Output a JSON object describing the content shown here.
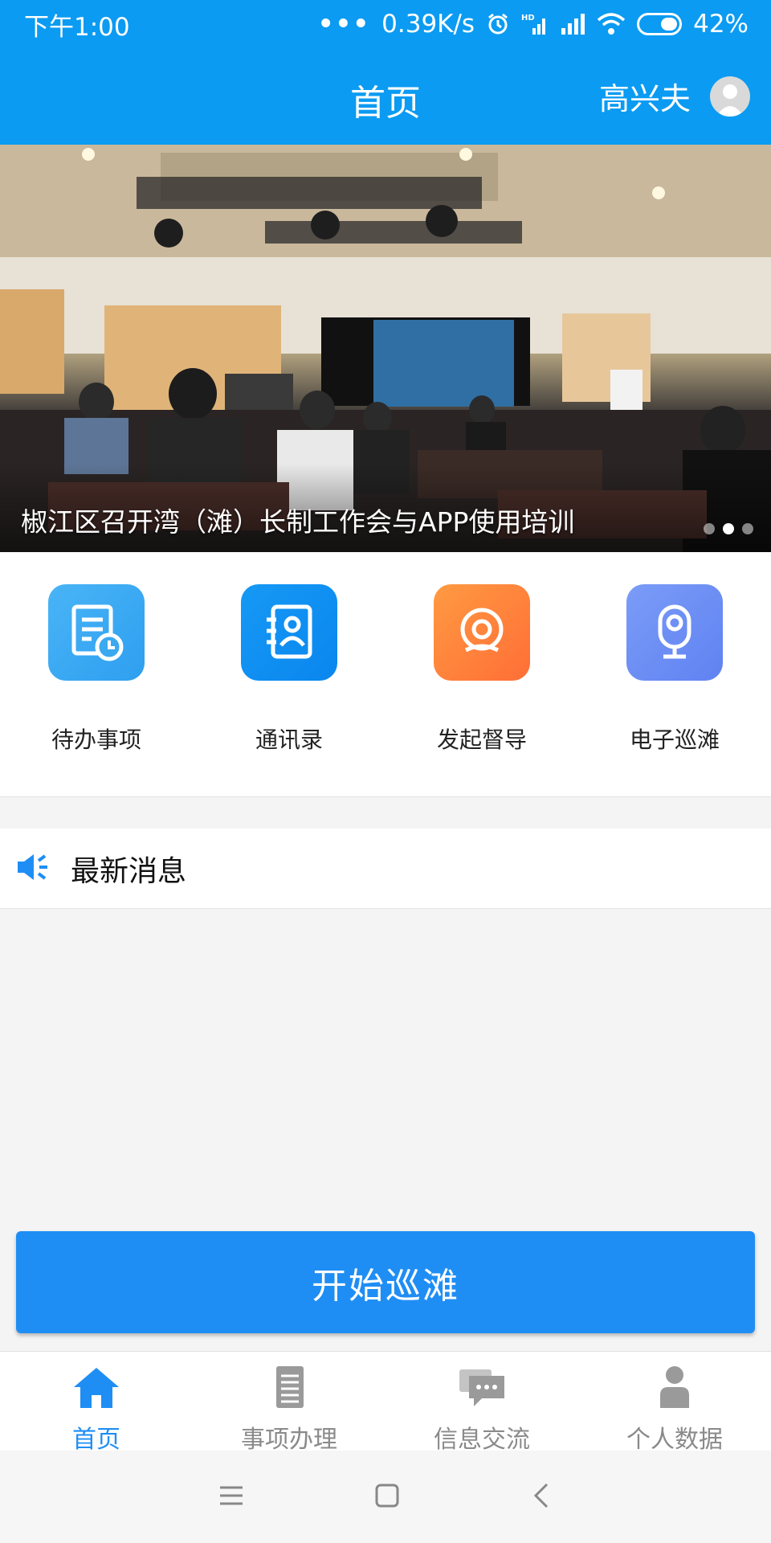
{
  "status_bar": {
    "time": "下午1:00",
    "network_speed": "0.39K/s",
    "battery": "42%",
    "icons": [
      "more-dots-icon",
      "alarm-icon",
      "hd-signal-icon",
      "signal-icon",
      "wifi-icon",
      "battery-icon"
    ]
  },
  "header": {
    "title": "首页",
    "username": "高兴夫",
    "avatar_icon": "user-avatar-icon",
    "color": "#0b9bf2"
  },
  "banner": {
    "caption": "椒江区召开湾（滩）长制工作会与APP使用培训",
    "slide_count": 3,
    "active_slide": 2
  },
  "quick_menu": {
    "items": [
      {
        "label": "待办事项",
        "icon": "todo-clock-icon",
        "color": "#3aa9f0"
      },
      {
        "label": "通讯录",
        "icon": "contacts-book-icon",
        "color": "#1e90f2"
      },
      {
        "label": "发起督导",
        "icon": "webcam-icon",
        "color": "#ff7e3b"
      },
      {
        "label": "电子巡滩",
        "icon": "camera-icon",
        "color": "#6b8cf5"
      }
    ]
  },
  "news": {
    "title": "最新消息",
    "icon": "megaphone-icon"
  },
  "start_button": {
    "label": "开始巡滩",
    "color": "#1f8ef4"
  },
  "bottom_nav": {
    "items": [
      {
        "label": "首页",
        "icon": "home-icon",
        "active": true
      },
      {
        "label": "事项办理",
        "icon": "document-icon",
        "active": false
      },
      {
        "label": "信息交流",
        "icon": "chat-icon",
        "active": false
      },
      {
        "label": "个人数据",
        "icon": "person-icon",
        "active": false
      }
    ]
  },
  "system_nav": {
    "icons": [
      "menu-icon",
      "home-square-icon",
      "back-icon"
    ]
  }
}
